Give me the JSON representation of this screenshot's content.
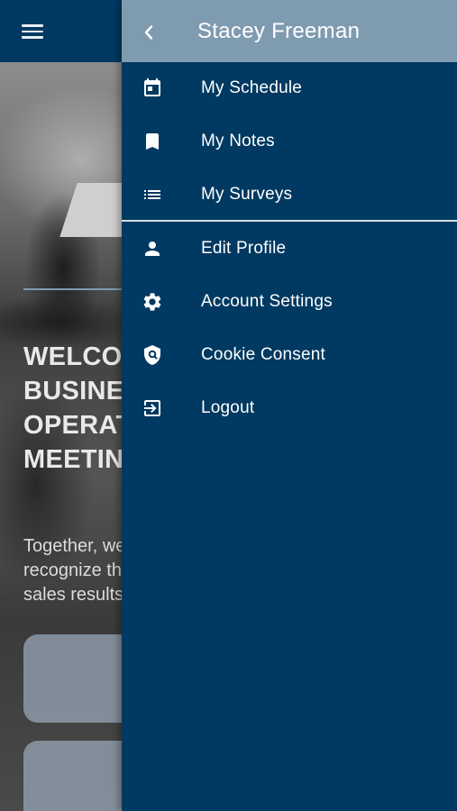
{
  "background_screen": {
    "welcome_heading": "WELCOME\nBUSINESS\nOPERATIONS\nMEETING",
    "intro_text": "Together, we\nrecognize the\nsales results"
  },
  "drawer": {
    "user_name": "Stacey Freeman",
    "primary_items": [
      {
        "label": "My Schedule",
        "icon": "calendar-icon"
      },
      {
        "label": "My Notes",
        "icon": "bookmark-icon"
      },
      {
        "label": "My Surveys",
        "icon": "list-icon"
      }
    ],
    "account_items": [
      {
        "label": "Edit Profile",
        "icon": "person-icon"
      },
      {
        "label": "Account Settings",
        "icon": "gear-icon"
      },
      {
        "label": "Cookie Consent",
        "icon": "shield-icon"
      },
      {
        "label": "Logout",
        "icon": "logout-icon"
      }
    ]
  },
  "colors": {
    "drawer_bg": "#003961",
    "drawer_header_bg": "#7f9bb0",
    "text": "#ffffff"
  }
}
